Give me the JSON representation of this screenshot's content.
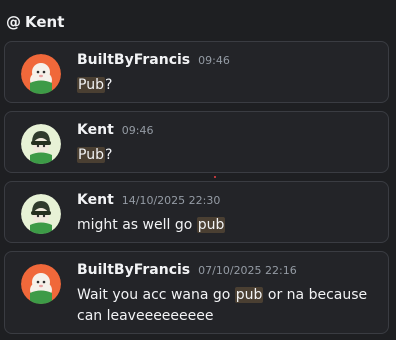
{
  "header": {
    "at": "@",
    "title": "Kent"
  },
  "messages": [
    {
      "author": "BuiltByFrancis",
      "time": "09:46",
      "before": "",
      "highlight": "Pub",
      "after": "?",
      "avatar": "francis-avatar"
    },
    {
      "author": "Kent",
      "time": "09:46",
      "before": "",
      "highlight": "Pub",
      "after": "?",
      "avatar": "kent-avatar"
    },
    {
      "author": "Kent",
      "time": "14/10/2025 22:30",
      "before": "might as well go ",
      "highlight": "pub",
      "after": "",
      "avatar": "kent-avatar"
    },
    {
      "author": "BuiltByFrancis",
      "time": "07/10/2025 22:16",
      "before": "Wait you acc wana go ",
      "highlight": "pub",
      "after": " or na because can leaveeeeeeeee",
      "avatar": "francis-avatar"
    }
  ],
  "colors": {
    "background": "#1e1f22",
    "card": "#232428",
    "highlight": "#4a3f32",
    "francis_avatar_bg": "#f0683a",
    "kent_avatar_bg": "#e7f2d6"
  }
}
